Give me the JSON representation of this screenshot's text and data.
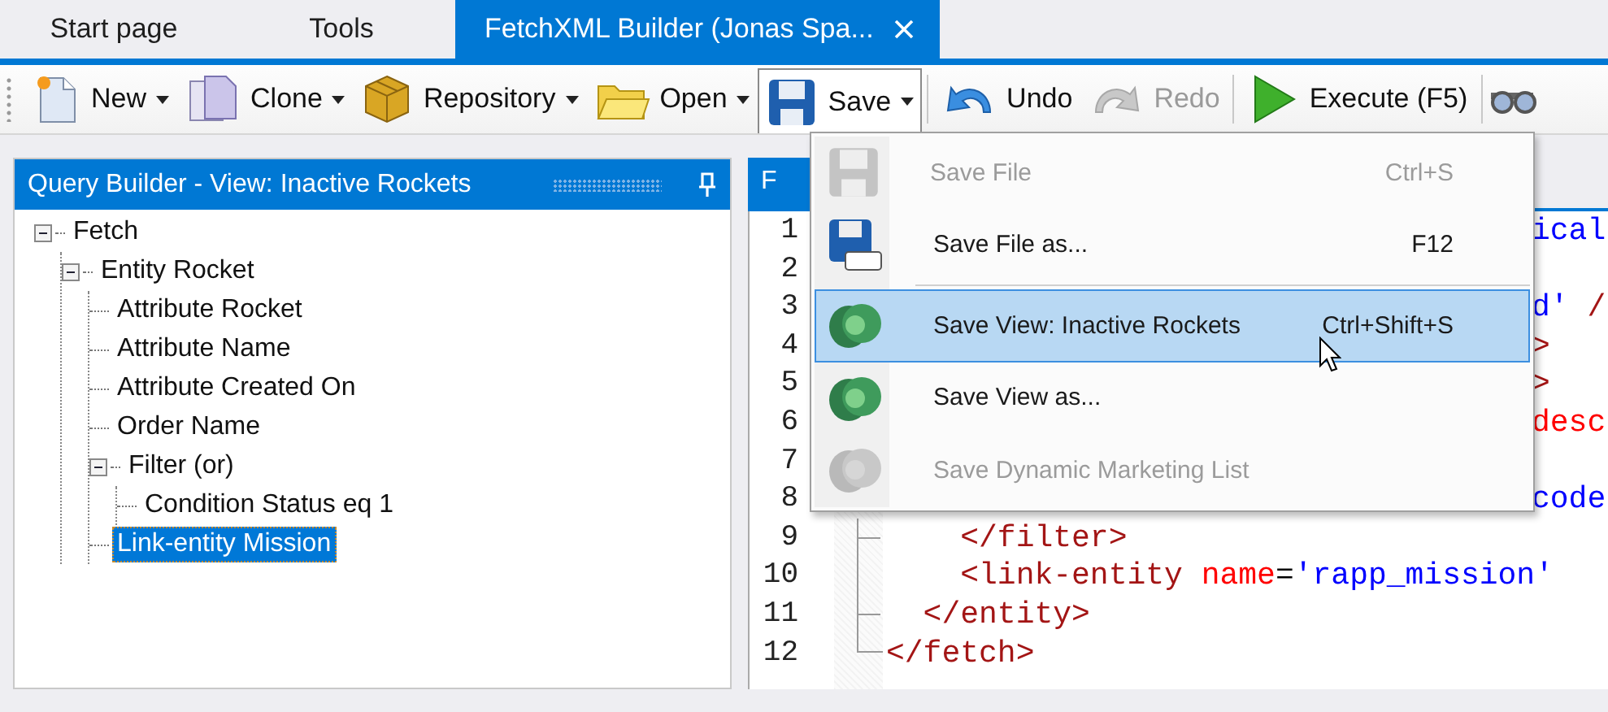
{
  "tabs": [
    {
      "label": "Start page",
      "selected": false,
      "closable": false
    },
    {
      "label": "Tools",
      "selected": false,
      "closable": false
    },
    {
      "label": "FetchXML Builder (Jonas Spa...",
      "selected": true,
      "closable": true
    }
  ],
  "toolbar": [
    {
      "kind": "button",
      "label": "New",
      "dropdown": true,
      "open": false,
      "disabled": false
    },
    {
      "kind": "button",
      "label": "Clone",
      "dropdown": true,
      "open": false,
      "disabled": false
    },
    {
      "kind": "button",
      "label": "Repository",
      "dropdown": true,
      "open": false,
      "disabled": false
    },
    {
      "kind": "button",
      "label": "Open",
      "dropdown": true,
      "open": false,
      "disabled": false
    },
    {
      "kind": "button",
      "label": "Save",
      "dropdown": true,
      "open": true,
      "disabled": false
    },
    {
      "kind": "separator"
    },
    {
      "kind": "button",
      "label": "Undo",
      "dropdown": false,
      "open": false,
      "disabled": false
    },
    {
      "kind": "button",
      "label": "Redo",
      "dropdown": false,
      "open": false,
      "disabled": true
    },
    {
      "kind": "separator"
    },
    {
      "kind": "button",
      "label": "Execute (F5)",
      "dropdown": false,
      "open": false,
      "disabled": false
    },
    {
      "kind": "separator"
    },
    {
      "kind": "icon"
    }
  ],
  "query_panel": {
    "title": "Query Builder - View: Inactive Rockets",
    "tree": [
      {
        "label": "Fetch",
        "expanded": true,
        "selected": false,
        "children": [
          {
            "label": "Entity Rocket",
            "expanded": true,
            "selected": false,
            "children": [
              {
                "label": "Attribute Rocket",
                "selected": false
              },
              {
                "label": "Attribute Name",
                "selected": false
              },
              {
                "label": "Attribute Created On",
                "selected": false
              },
              {
                "label": "Order Name",
                "selected": false
              },
              {
                "label": "Filter (or)",
                "expanded": true,
                "selected": false,
                "children": [
                  {
                    "label": "Condition Status eq 1",
                    "selected": false
                  }
                ]
              },
              {
                "label": "Link-entity Mission",
                "selected": true
              }
            ]
          }
        ]
      }
    ]
  },
  "editor": {
    "tab": "F",
    "lines": [
      {
        "number": "1",
        "hidden_start": true,
        "tokens": [
          {
            "text": "ical",
            "kind": "value"
          }
        ]
      },
      {
        "number": "2"
      },
      {
        "number": "3",
        "hidden_start": true,
        "tokens": [
          {
            "text": "d'",
            "kind": "value"
          },
          {
            "text": " /",
            "kind": "tag"
          }
        ]
      },
      {
        "number": "4",
        "hidden_start": true,
        "tokens": [
          {
            "text": ">",
            "kind": "tag"
          }
        ]
      },
      {
        "number": "5",
        "hidden_start": true,
        "tokens": [
          {
            "text": ">",
            "kind": "tag"
          }
        ]
      },
      {
        "number": "6",
        "hidden_start": true,
        "tokens": [
          {
            "text": "desc",
            "kind": "attr"
          }
        ]
      },
      {
        "number": "7"
      },
      {
        "number": "8",
        "hidden_start": true,
        "tokens": [
          {
            "text": "code",
            "kind": "value"
          }
        ]
      },
      {
        "number": "9",
        "hidden_start": false,
        "tokens": [
          {
            "text": "    </filter>",
            "kind": "tag"
          }
        ]
      },
      {
        "number": "10",
        "hidden_start": false,
        "tokens": [
          {
            "text": "    <link-entity",
            "kind": "tag"
          },
          {
            "text": " name",
            "kind": "attr"
          },
          {
            "text": "=",
            "kind": "plain"
          },
          {
            "text": "'rapp_mission'",
            "kind": "value"
          }
        ]
      },
      {
        "number": "11",
        "hidden_start": false,
        "tokens": [
          {
            "text": "  </entity>",
            "kind": "tag"
          }
        ]
      },
      {
        "number": "12",
        "hidden_start": false,
        "tokens": [
          {
            "text": "</fetch>",
            "kind": "tag"
          }
        ]
      }
    ]
  },
  "save_menu": [
    {
      "kind": "item",
      "label": "Save File",
      "shortcut": "Ctrl+S",
      "disabled": true,
      "selected": false
    },
    {
      "kind": "item",
      "label": "Save File as...",
      "shortcut": "F12",
      "disabled": false,
      "selected": false
    },
    {
      "kind": "separator"
    },
    {
      "kind": "item",
      "label": "Save View: Inactive Rockets",
      "shortcut": "Ctrl+Shift+S",
      "disabled": false,
      "selected": true
    },
    {
      "kind": "item",
      "label": "Save View as...",
      "disabled": false,
      "selected": false
    },
    {
      "kind": "item",
      "label": "Save Dynamic Marketing List",
      "disabled": true,
      "selected": false
    }
  ]
}
